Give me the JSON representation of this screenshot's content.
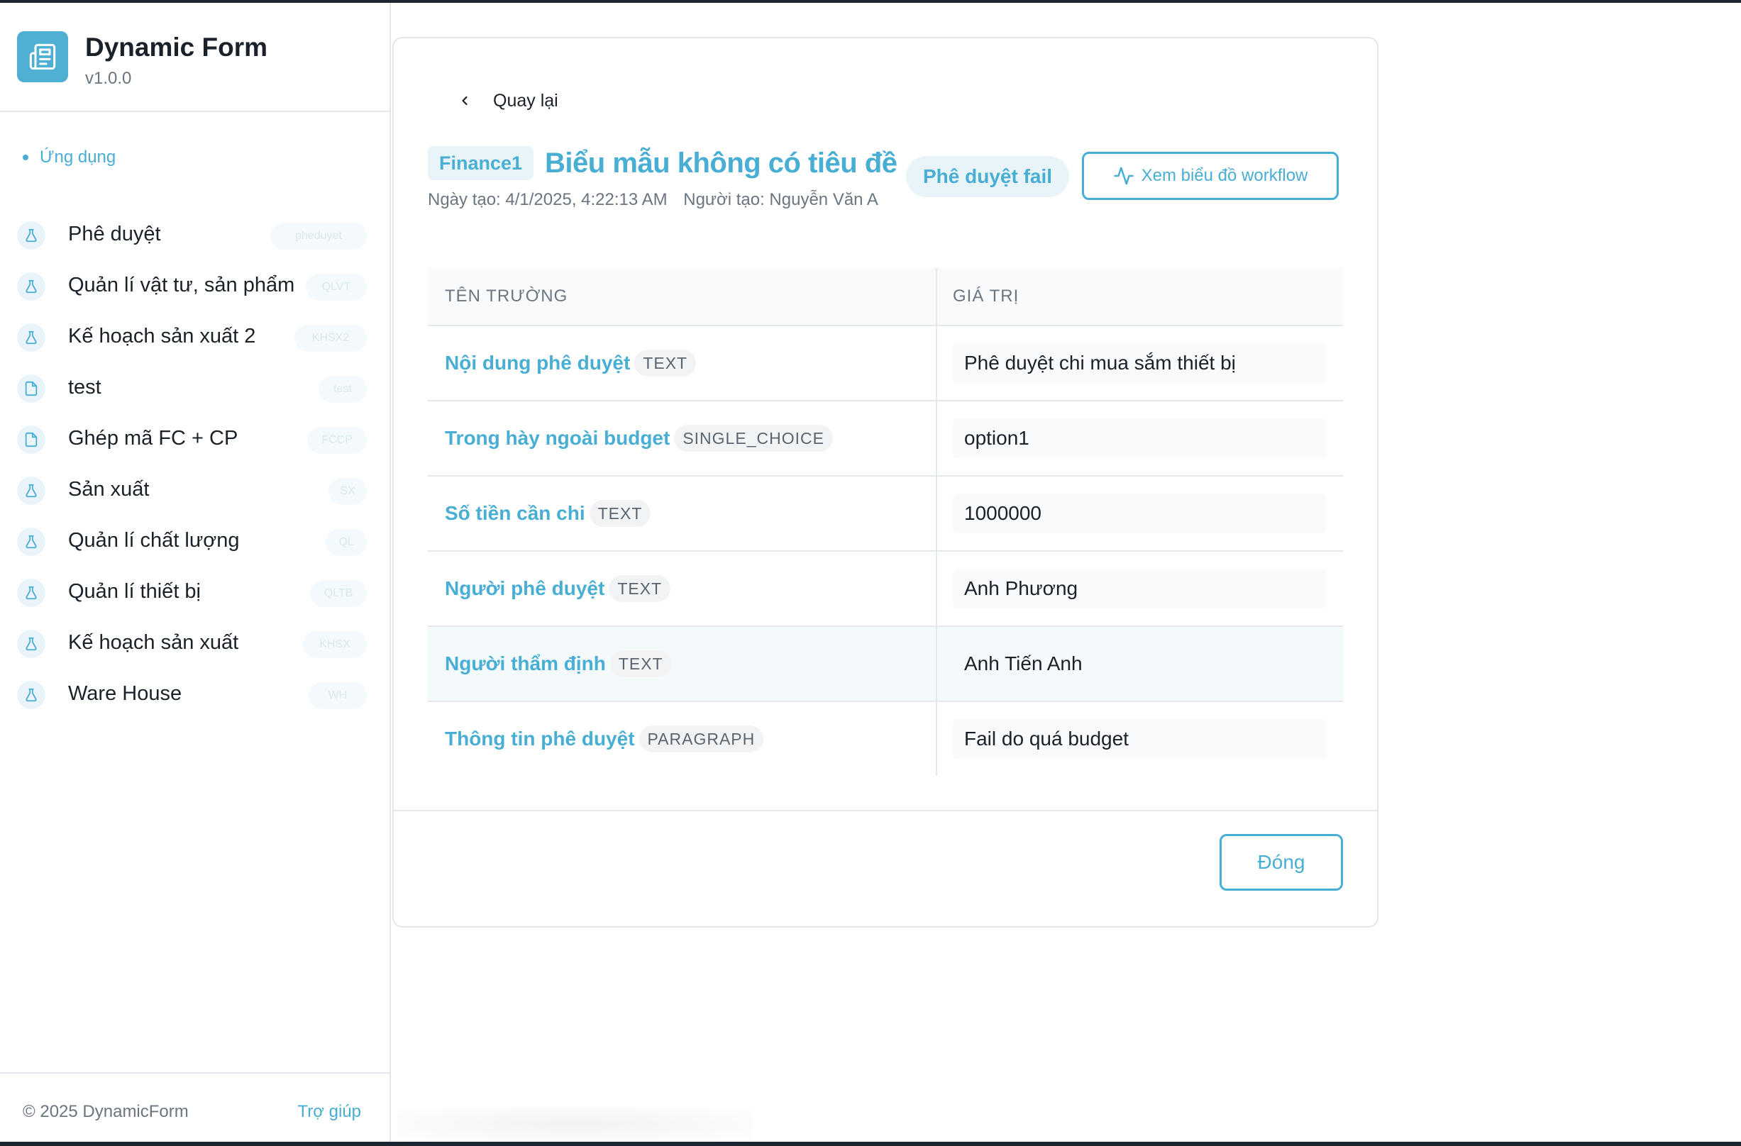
{
  "app": {
    "title": "Dynamic Form",
    "version": "v1.0.0"
  },
  "sidebar": {
    "section_label": "Ứng dụng",
    "items": [
      {
        "label": "Phê duyệt",
        "icon": "flask-icon",
        "badge": "pheduyet"
      },
      {
        "label": "Quản lí vật tư, sản phẩm",
        "icon": "flask-icon",
        "badge": "QLVT"
      },
      {
        "label": "Kế hoạch sản xuất 2",
        "icon": "flask-icon",
        "badge": "KHSX2"
      },
      {
        "label": "test",
        "icon": "document-icon",
        "badge": "test"
      },
      {
        "label": "Ghép mã FC + CP",
        "icon": "document-icon",
        "badge": "FCCP"
      },
      {
        "label": "Sản xuất",
        "icon": "flask-icon",
        "badge": "SX"
      },
      {
        "label": "Quản lí chất lượng",
        "icon": "flask-icon",
        "badge": "QL"
      },
      {
        "label": "Quản lí thiết bị",
        "icon": "flask-icon",
        "badge": "QLTB"
      },
      {
        "label": "Kế hoạch sản xuất",
        "icon": "flask-icon",
        "badge": "KHSX"
      },
      {
        "label": "Ware House",
        "icon": "flask-icon",
        "badge": "WH"
      }
    ],
    "footer": {
      "copyright": "© 2025 DynamicForm",
      "help": "Trợ giúp"
    }
  },
  "detail": {
    "back_label": "Quay lại",
    "code": "Finance1",
    "title": "Biểu mẫu không có tiêu đề",
    "created_at": "Ngày tạo: 4/1/2025, 4:22:13 AM",
    "created_by": "Người tạo: Nguyễn Văn A",
    "status": "Phê duyệt fail",
    "workflow_button": "Xem biểu đồ workflow",
    "close_button": "Đóng"
  },
  "table": {
    "headers": [
      "TÊN TRƯỜNG",
      "GIÁ TRỊ"
    ],
    "rows": [
      {
        "field": "Nội dung phê duyệt",
        "type": "TEXT",
        "value": "Phê duyệt chi mua sắm thiết bị"
      },
      {
        "field": "Trong hày ngoài budget",
        "type": "SINGLE_CHOICE",
        "value": "option1"
      },
      {
        "field": "Số tiền cần chi",
        "type": "TEXT",
        "value": "1000000"
      },
      {
        "field": "Người phê duyệt",
        "type": "TEXT",
        "value": "Anh Phương"
      },
      {
        "field": "Người thẩm định",
        "type": "TEXT",
        "value": "Anh Tiến Anh"
      },
      {
        "field": "Thông tin phê duyệt",
        "type": "PARAGRAPH",
        "value": "Fail do quá budget"
      }
    ]
  },
  "colors": {
    "accent": "#49aed3",
    "accent_light": "#e9f4f9",
    "text_primary": "#1b2129",
    "text_muted": "#6b7580",
    "border": "#e4e7eb"
  }
}
